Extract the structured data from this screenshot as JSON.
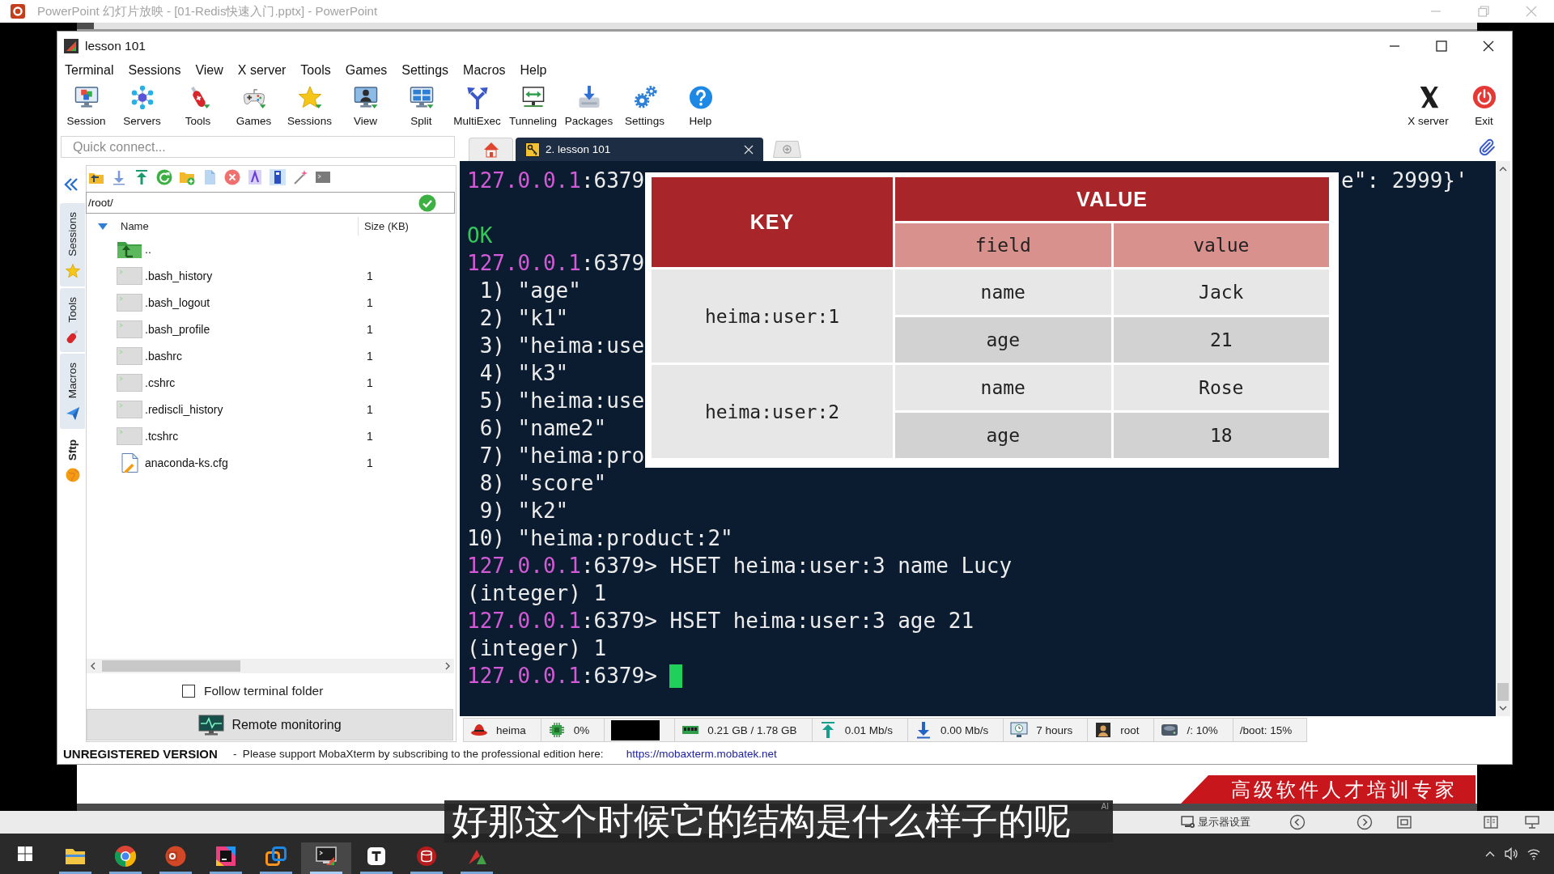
{
  "ppt_window": {
    "title": "PowerPoint 幻灯片放映 - [01-Redis快速入门.pptx] - PowerPoint"
  },
  "window": {
    "title": "lesson 101"
  },
  "menu": [
    "Terminal",
    "Sessions",
    "View",
    "X server",
    "Tools",
    "Games",
    "Settings",
    "Macros",
    "Help"
  ],
  "toolbar": [
    {
      "label": "Session"
    },
    {
      "label": "Servers"
    },
    {
      "label": "Tools"
    },
    {
      "label": "Games"
    },
    {
      "label": "Sessions"
    },
    {
      "label": "View"
    },
    {
      "label": "Split"
    },
    {
      "label": "MultiExec"
    },
    {
      "label": "Tunneling"
    },
    {
      "label": "Packages"
    },
    {
      "label": "Settings"
    },
    {
      "label": "Help"
    }
  ],
  "toolbar_right": [
    {
      "label": "X server"
    },
    {
      "label": "Exit"
    }
  ],
  "quick_connect": {
    "placeholder": "Quick connect..."
  },
  "tabs": [
    {
      "kind": "home",
      "selected": false
    },
    {
      "kind": "session",
      "label": "2. lesson 101",
      "selected": true
    }
  ],
  "side_tabs": [
    {
      "label": "Sessions",
      "selected": false
    },
    {
      "label": "Tools",
      "selected": false
    },
    {
      "label": "Macros",
      "selected": false
    },
    {
      "label": "Sftp",
      "selected": true
    }
  ],
  "sftp": {
    "path": "/root/",
    "columns": [
      "Name",
      "Size (KB)"
    ],
    "files": [
      {
        "kind": "parent",
        "name": ".."
      },
      {
        "kind": "script",
        "name": ".bash_history",
        "size": "1"
      },
      {
        "kind": "script",
        "name": ".bash_logout",
        "size": "1"
      },
      {
        "kind": "script",
        "name": ".bash_profile",
        "size": "1"
      },
      {
        "kind": "script",
        "name": ".bashrc",
        "size": "1"
      },
      {
        "kind": "script",
        "name": ".cshrc",
        "size": "1"
      },
      {
        "kind": "script",
        "name": ".rediscli_history",
        "size": "1"
      },
      {
        "kind": "script",
        "name": ".tcshrc",
        "size": "1"
      },
      {
        "kind": "document",
        "name": "anaconda-ks.cfg",
        "size": "1"
      }
    ],
    "follow_terminal": {
      "label": "Follow terminal folder",
      "checked": false
    },
    "remote_monitoring": "Remote monitoring"
  },
  "terminal": {
    "lines": [
      {
        "kind": "prompt",
        "host": "127.0.0.1",
        "port": ":6379",
        "tail": "e\": 2999}'"
      },
      {
        "kind": "blank"
      },
      {
        "kind": "ok",
        "text": "OK"
      },
      {
        "kind": "prompt",
        "host": "127.0.0.1",
        "port": ":6379"
      },
      {
        "kind": "item",
        "index": "1)",
        "value": "\"age\""
      },
      {
        "kind": "item",
        "index": "2)",
        "value": "\"k1\""
      },
      {
        "kind": "item",
        "index": "3)",
        "value": "\"heima:use"
      },
      {
        "kind": "item",
        "index": "4)",
        "value": "\"k3\""
      },
      {
        "kind": "item",
        "index": "5)",
        "value": "\"heima:use"
      },
      {
        "kind": "item",
        "index": "6)",
        "value": "\"name2\""
      },
      {
        "kind": "item",
        "index": "7)",
        "value": "\"heima:pro"
      },
      {
        "kind": "item",
        "index": "8)",
        "value": "\"score\""
      },
      {
        "kind": "item",
        "index": "9)",
        "value": "\"k2\""
      },
      {
        "kind": "item",
        "index": "10)",
        "value": "\"heima:product:2\""
      },
      {
        "kind": "prompt",
        "host": "127.0.0.1",
        "port": ":6379>",
        "command": "HSET heima:user:3 name Lucy"
      },
      {
        "kind": "output",
        "text": "(integer) 1"
      },
      {
        "kind": "prompt",
        "host": "127.0.0.1",
        "port": ":6379>",
        "command": "HSET heima:user:3 age 21"
      },
      {
        "kind": "output",
        "text": "(integer) 1"
      },
      {
        "kind": "prompt",
        "host": "127.0.0.1",
        "port": ":6379>",
        "cursor": true
      }
    ]
  },
  "hash_table": {
    "headers": {
      "key": "KEY",
      "value": "VALUE",
      "field": "field",
      "value_sub": "value"
    },
    "rows": [
      {
        "key": "heima:user:1",
        "fields": [
          {
            "field": "name",
            "value": "Jack"
          },
          {
            "field": "age",
            "value": "21"
          }
        ]
      },
      {
        "key": "heima:user:2",
        "fields": [
          {
            "field": "name",
            "value": "Rose"
          },
          {
            "field": "age",
            "value": "18"
          }
        ]
      }
    ]
  },
  "status_bar": [
    {
      "kind": "user",
      "text": "heima"
    },
    {
      "kind": "cpu",
      "text": "0%"
    },
    {
      "kind": "graph"
    },
    {
      "kind": "memory",
      "text": "0.21 GB / 1.78 GB"
    },
    {
      "kind": "upload",
      "text": "0.01 Mb/s"
    },
    {
      "kind": "download",
      "text": "0.00 Mb/s"
    },
    {
      "kind": "uptime",
      "text": "7 hours"
    },
    {
      "kind": "login",
      "text": "root"
    },
    {
      "kind": "disk",
      "text": "/: 10%"
    },
    {
      "kind": "plain",
      "text": "/boot: 15%"
    }
  ],
  "notice": {
    "label": "UNREGISTERED VERSION",
    "message": "-  Please support MobaXterm by subscribing to the professional edition here:",
    "link": "https://mobaxterm.mobatek.net"
  },
  "slide": {
    "banner": "高级软件人才培训专家"
  },
  "presenter_bar": {
    "display_settings": "显示器设置"
  },
  "subtitle": {
    "text": "好那这个时候它的结构是什么样子的呢",
    "tag": "AI"
  },
  "taskbar": {
    "apps": [
      {
        "running": true,
        "selected": false
      },
      {
        "running": true,
        "selected": false
      },
      {
        "running": true,
        "selected": false
      },
      {
        "running": true,
        "selected": false
      },
      {
        "running": true,
        "selected": false
      },
      {
        "running": true,
        "selected": true
      },
      {
        "running": true,
        "selected": false
      },
      {
        "running": true,
        "selected": false
      },
      {
        "running": true,
        "selected": false
      }
    ]
  }
}
